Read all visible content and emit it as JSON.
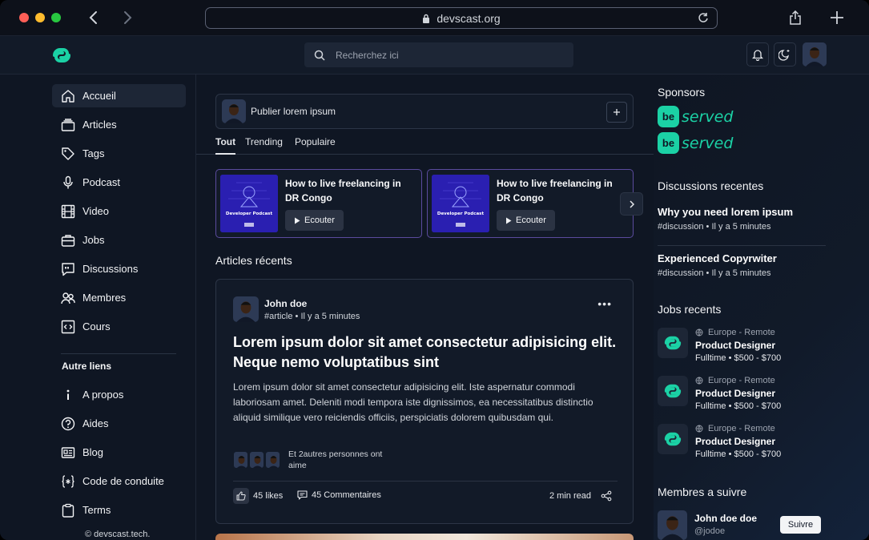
{
  "browser": {
    "url": "devscast.org"
  },
  "header": {
    "search_placeholder": "Recherchez ici"
  },
  "sidebar": {
    "items": [
      {
        "label": "Accueil",
        "icon": "home-icon"
      },
      {
        "label": "Articles",
        "icon": "articles-icon"
      },
      {
        "label": "Tags",
        "icon": "tag-icon"
      },
      {
        "label": "Podcast",
        "icon": "microphone-icon"
      },
      {
        "label": "Video",
        "icon": "film-icon"
      },
      {
        "label": "Jobs",
        "icon": "briefcase-icon"
      },
      {
        "label": "Discussions",
        "icon": "quote-icon"
      },
      {
        "label": "Membres",
        "icon": "users-icon"
      },
      {
        "label": "Cours",
        "icon": "code-icon"
      }
    ],
    "other_heading": "Autre liens",
    "other_items": [
      {
        "label": "A propos",
        "icon": "info-icon"
      },
      {
        "label": "Aides",
        "icon": "help-icon"
      },
      {
        "label": "Blog",
        "icon": "newspaper-icon"
      },
      {
        "label": "Code de conduite",
        "icon": "braces-icon"
      },
      {
        "label": "Terms",
        "icon": "clipboard-icon"
      }
    ],
    "footer": "© devscast.tech."
  },
  "main": {
    "composer_label": "Publier lorem ipsum",
    "tabs": [
      "Tout",
      "Trending",
      "Populaire"
    ],
    "podcasts": [
      {
        "title": "How to live freelancing in DR Congo",
        "button": "Ecouter",
        "cover_text": "Developer Podcast"
      },
      {
        "title": "How to live freelancing in DR Congo",
        "button": "Ecouter",
        "cover_text": "Developer Podcast"
      }
    ],
    "section_title": "Articles récents",
    "article": {
      "author": "John doe",
      "tag": "#article",
      "time": "Il y a 5 minutes",
      "headline": "Lorem ipsum dolor sit amet consectetur adipisicing elit. Neque nemo voluptatibus sint",
      "body": "Lorem ipsum dolor sit amet consectetur adipisicing elit. Iste aspernatur commodi laboriosam amet. Deleniti modi tempora iste dignissimos, ea necessitatibus distinctio aliquid similique vero reiciendis officiis, perspiciatis dolorem quibusdam qui.",
      "others": "Et 2autres personnes ont aime",
      "likes": "45 likes",
      "comments": "45 Commentaires",
      "read_time": "2 min read"
    }
  },
  "right": {
    "sponsors_title": "Sponsors",
    "sponsors": [
      {
        "badge": "be",
        "word": "served"
      },
      {
        "badge": "be",
        "word": "served"
      }
    ],
    "discussions_title": "Discussions recentes",
    "discussions": [
      {
        "title": "Why you need lorem ipsum",
        "tag": "#discussion",
        "time": "Il y a 5 minutes"
      },
      {
        "title": "Experienced Copyrwiter",
        "tag": "#discussion",
        "time": "Il y a 5 minutes"
      }
    ],
    "jobs_title": "Jobs recents",
    "jobs": [
      {
        "location": "Europe - Remote",
        "title": "Product Designer",
        "type": "Fulltime",
        "salary": "$500 - $700"
      },
      {
        "location": "Europe - Remote",
        "title": "Product Designer",
        "type": "Fulltime",
        "salary": "$500 - $700"
      },
      {
        "location": "Europe - Remote",
        "title": "Product Designer",
        "type": "Fulltime",
        "salary": "$500 - $700"
      }
    ],
    "members_title": "Membres a suivre",
    "member": {
      "name": "John doe doe",
      "handle": "@jodoe",
      "button": "Suivre"
    }
  },
  "colors": {
    "accent": "#1bd1a5",
    "background": "#0f1623",
    "podcast_cover": "#2a1fb1"
  }
}
